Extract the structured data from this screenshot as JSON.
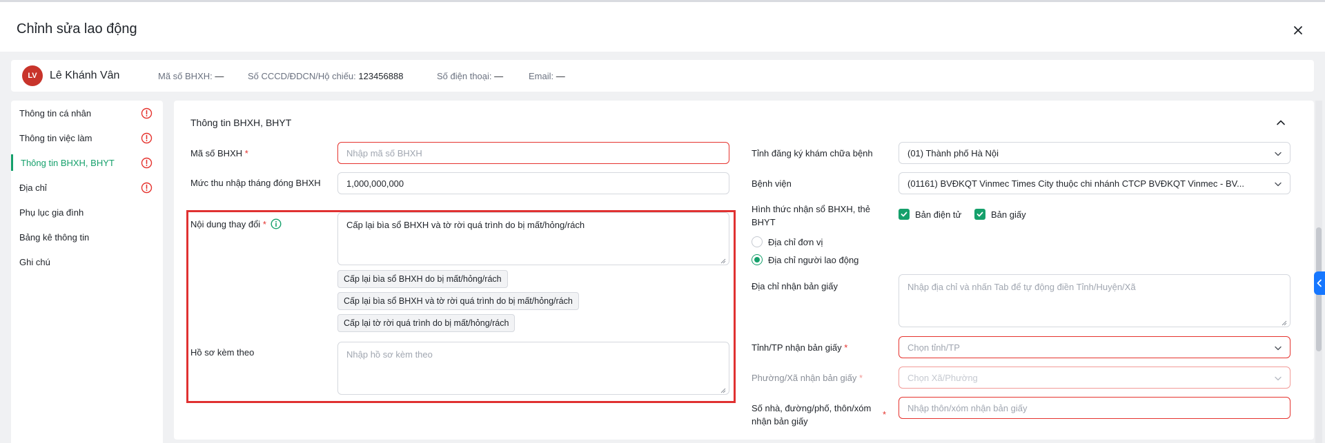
{
  "dialog": {
    "title": "Chỉnh sửa lao động"
  },
  "person": {
    "initials": "LV",
    "name": "Lê Khánh Vân",
    "fields": [
      {
        "label": "Mã số BHXH:",
        "value": "—"
      },
      {
        "label": "Số CCCD/ĐDCN/Hộ chiếu:",
        "value": "123456888"
      },
      {
        "label": "Số điện thoại:",
        "value": "—"
      },
      {
        "label": "Email:",
        "value": "—"
      }
    ]
  },
  "sidebar": {
    "items": [
      {
        "label": "Thông tin cá nhân",
        "warning": true
      },
      {
        "label": "Thông tin việc làm",
        "warning": true
      },
      {
        "label": "Thông tin BHXH, BHYT",
        "warning": true,
        "active": true
      },
      {
        "label": "Địa chỉ",
        "warning": true
      },
      {
        "label": "Phụ lục gia đình",
        "warning": false
      },
      {
        "label": "Bảng kê thông tin",
        "warning": false
      },
      {
        "label": "Ghi chú",
        "warning": false
      }
    ]
  },
  "section": {
    "title": "Thông tin BHXH, BHYT"
  },
  "left": {
    "ma_so": {
      "label": "Mã số BHXH",
      "required": "*",
      "placeholder": "Nhập mã số BHXH"
    },
    "muc_thu": {
      "label": "Mức thu nhập tháng đóng BHXH",
      "value": "1,000,000,000"
    },
    "noi_dung": {
      "label": "Nội dung thay đổi",
      "required": "*",
      "value": "Cấp lại bìa sổ BHXH và tờ rời quá trình do bị mất/hỏng/rách",
      "suggestions": [
        "Cấp lại bìa sổ BHXH do bị mất/hỏng/rách",
        "Cấp lại bìa sổ BHXH và tờ rời quá trình do bị mất/hỏng/rách",
        "Cấp lại tờ rời quá trình do bị mất/hỏng/rách"
      ]
    },
    "ho_so": {
      "label": "Hồ sơ kèm theo",
      "placeholder": "Nhập hồ sơ kèm theo"
    }
  },
  "right": {
    "tinh_kham": {
      "label": "Tỉnh đăng ký khám chữa bệnh",
      "value": "(01) Thành phố Hà Nội"
    },
    "benh_vien": {
      "label": "Bệnh viện",
      "value": "(01161) BVĐKQT Vinmec Times City thuộc chi nhánh CTCP BVĐKQT Vinmec - BV..."
    },
    "hinh_thuc": {
      "label": "Hình thức nhận sổ BHXH, thẻ BHYT",
      "checkboxes": [
        "Bản điện tử",
        "Bản giấy"
      ],
      "radios": [
        "Địa chỉ đơn vị",
        "Địa chỉ người lao động"
      ]
    },
    "dia_chi_giay": {
      "label": "Địa chỉ nhận bản giấy",
      "placeholder": "Nhập địa chỉ và nhấn Tab để tự động điền Tỉnh/Huyện/Xã"
    },
    "tinh_tp": {
      "label": "Tỉnh/TP nhận bản giấy",
      "required": "*",
      "placeholder": "Chọn tỉnh/TP"
    },
    "phuong_xa": {
      "label": "Phường/Xã nhận bản giấy",
      "required": "*",
      "placeholder": "Chọn Xã/Phường"
    },
    "so_nha": {
      "label": "Số nhà, đường/phố, thôn/xóm nhận bản giấy",
      "required": "*",
      "placeholder": "Nhập thôn/xóm nhận bản giấy"
    }
  },
  "colors": {
    "accent": "#15a06b",
    "error": "#e5322d",
    "avatar": "#c8342b",
    "highlight": "#e03131",
    "sidetab": "#1677ff"
  },
  "icons": {
    "close": "close-icon",
    "collapse": "chevron-up-icon",
    "warning": "alert-circle-icon",
    "info": "info-icon",
    "select": "chevron-down-icon",
    "sidetab": "chevron-left-icon"
  }
}
